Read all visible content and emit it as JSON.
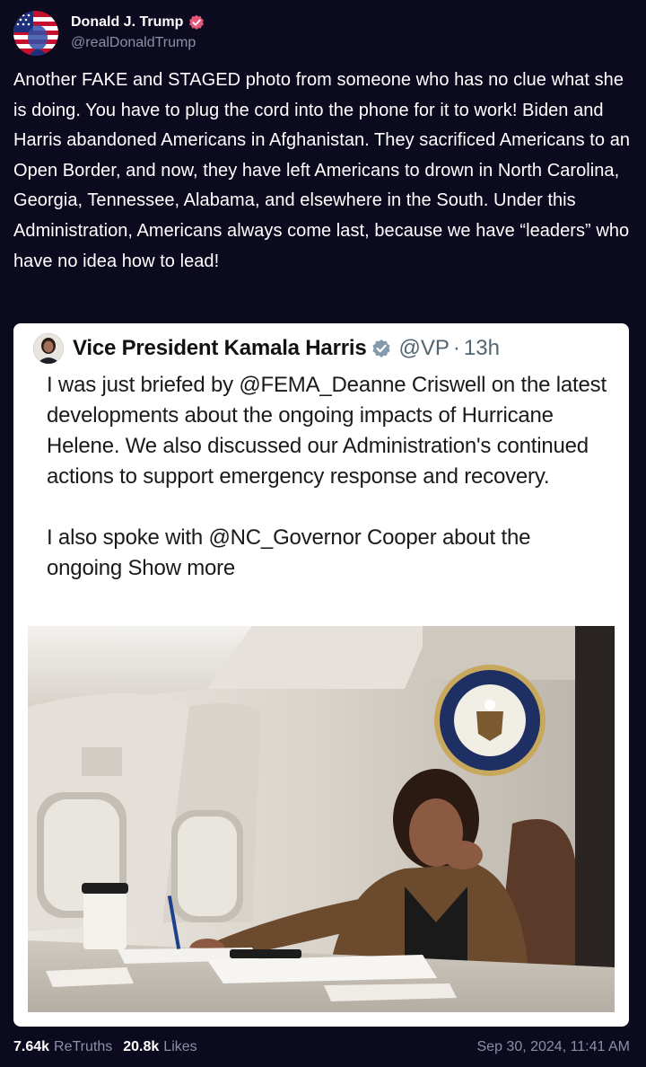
{
  "author": {
    "name": "Donald J. Trump",
    "handle": "@realDonaldTrump",
    "verified_color": "#e4577a",
    "avatar_icon": "flag-portrait-avatar"
  },
  "post": {
    "text": "Another FAKE and STAGED photo from someone who has no clue what she is doing. You have to plug the cord into the phone for it to work! Biden and Harris abandoned Americans in Afghanistan. They sacrificed Americans to an Open Border, and now, they have left Americans to drown in North Carolina, Georgia, Tennessee, Alabama, and elsewhere in the South. Under this Administration, Americans always come last, because we have “leaders” who have no idea how to lead!"
  },
  "embed": {
    "name": "Vice President Kamala Harris",
    "handle": "@VP",
    "separator": "·",
    "time": "13h",
    "paragraph1": "I was just briefed by @FEMA_Deanne Criswell on the latest developments about the ongoing impacts of Hurricane Helene. We also discussed our Administration's continued actions to support emergency response and recovery.",
    "paragraph2_prefix": "I also spoke with @NC_Governor Cooper about the ongoing",
    "show_more": "Show more",
    "seal_text": "PRESIDENT OF THE UNITED STATES"
  },
  "stats": {
    "retruths_count": "7.64k",
    "retruths_label": "ReTruths",
    "likes_count": "20.8k",
    "likes_label": "Likes",
    "timestamp": "Sep 30, 2024, 11:41 AM"
  },
  "colors": {
    "background": "#0b0a1f",
    "muted_text": "#8f8ea6",
    "badge_gray": "#829aab"
  }
}
